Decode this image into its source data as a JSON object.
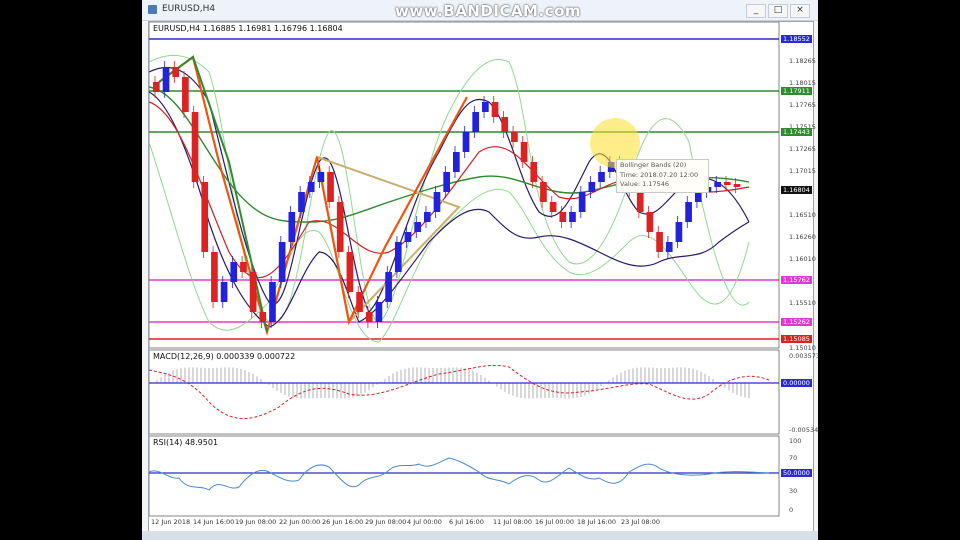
{
  "window": {
    "title": "EURUSD,H4",
    "controls": [
      "_",
      "□",
      "×"
    ]
  },
  "watermark": "www.BANDICAM.com",
  "price_panel": {
    "header": "EURUSD,H4  1.16885 1.16981 1.16796 1.16804",
    "axis_labels": [
      "1.18265",
      "1.18015",
      "1.17765",
      "1.17515",
      "1.17265",
      "1.17015",
      "1.16510",
      "1.16260",
      "1.16010",
      "1.15510",
      "1.15010"
    ],
    "level_tags": [
      {
        "text": "1.18552",
        "color": "#2b2bcc"
      },
      {
        "text": "1.17911",
        "color": "#2e8b2e"
      },
      {
        "text": "1.17443",
        "color": "#2e8b2e"
      },
      {
        "text": "1.16804",
        "color": "#111111"
      },
      {
        "text": "1.15762",
        "color": "#e03ad0"
      },
      {
        "text": "1.15262",
        "color": "#e03ad0"
      },
      {
        "text": "1.15085",
        "color": "#e02020"
      }
    ],
    "tooltip": {
      "line1": "Bollinger Bands (20)",
      "line2": "Time: 2018.07.20 12:00",
      "line3": "Value: 1.17546"
    }
  },
  "macd_panel": {
    "header": "MACD(12,26,9) 0.000339 0.000722",
    "axis_top": "0.003573",
    "axis_mid": "0.00000",
    "axis_bottom": "-0.005340"
  },
  "rsi_panel": {
    "header": "RSI(14) 48.9501",
    "axis_top": "100",
    "axis_70": "70",
    "axis_level": "50.0000",
    "axis_30": "30",
    "axis_0": "0"
  },
  "time_axis": [
    "12 Jun 2018",
    "14 Jun 16:00",
    "19 Jun 08:00",
    "22 Jun 00:00",
    "26 Jun 16:00",
    "29 Jun 08:00",
    "4 Jul 00:00",
    "6 Jul 16:00",
    "11 Jul 08:00",
    "16 Jul 00:00",
    "18 Jul 16:00",
    "23 Jul 08:00"
  ],
  "colors": {
    "up_candle": "#2222dd",
    "down_candle": "#dd2222",
    "bb_outer": "#90d890",
    "bb_inner": "#2a1a6a",
    "ma_green": "#2e8b2e",
    "zigzag": "#ee5511",
    "triangle": "#c8b070"
  }
}
